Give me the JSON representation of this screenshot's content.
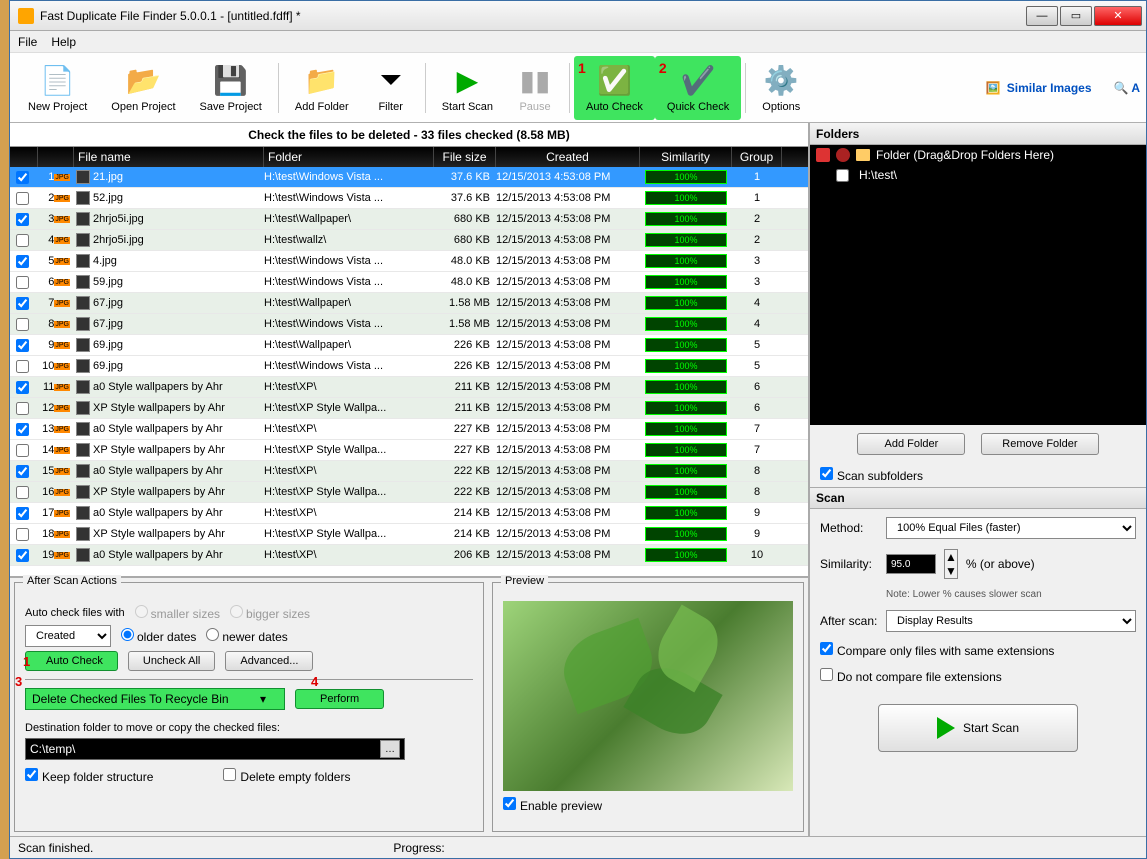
{
  "title": "Fast Duplicate File Finder 5.0.0.1 - [untitled.fdff] *",
  "menu": {
    "file": "File",
    "help": "Help"
  },
  "toolbar": {
    "new_project": "New Project",
    "open_project": "Open Project",
    "save_project": "Save Project",
    "add_folder": "Add Folder",
    "filter": "Filter",
    "start_scan": "Start Scan",
    "pause": "Pause",
    "auto_check": "Auto Check",
    "quick_check": "Quick Check",
    "options": "Options",
    "similar_images": "Similar Images",
    "annot1": "1",
    "annot2": "2"
  },
  "header_strip": "Check the files to be deleted - 33 files checked (8.58 MB)",
  "columns": {
    "name": "File name",
    "folder": "Folder",
    "size": "File size",
    "created": "Created",
    "similarity": "Similarity",
    "group": "Group"
  },
  "rows": [
    {
      "n": 1,
      "ck": true,
      "sel": true,
      "name": "21.jpg",
      "folder": "H:\\test\\Windows Vista ...",
      "size": "37.6 KB",
      "created": "12/15/2013 4:53:08 PM",
      "sim": "100%",
      "grp": "1"
    },
    {
      "n": 2,
      "ck": false,
      "name": "52.jpg",
      "folder": "H:\\test\\Windows Vista ...",
      "size": "37.6 KB",
      "created": "12/15/2013 4:53:08 PM",
      "sim": "100%",
      "grp": "1"
    },
    {
      "n": 3,
      "ck": true,
      "alt": true,
      "name": "2hrjo5i.jpg",
      "folder": "H:\\test\\Wallpaper\\",
      "size": "680 KB",
      "created": "12/15/2013 4:53:08 PM",
      "sim": "100%",
      "grp": "2"
    },
    {
      "n": 4,
      "ck": false,
      "alt": true,
      "name": "2hrjo5i.jpg",
      "folder": "H:\\test\\wallz\\",
      "size": "680 KB",
      "created": "12/15/2013 4:53:08 PM",
      "sim": "100%",
      "grp": "2"
    },
    {
      "n": 5,
      "ck": true,
      "name": "4.jpg",
      "folder": "H:\\test\\Windows Vista ...",
      "size": "48.0 KB",
      "created": "12/15/2013 4:53:08 PM",
      "sim": "100%",
      "grp": "3"
    },
    {
      "n": 6,
      "ck": false,
      "name": "59.jpg",
      "folder": "H:\\test\\Windows Vista ...",
      "size": "48.0 KB",
      "created": "12/15/2013 4:53:08 PM",
      "sim": "100%",
      "grp": "3"
    },
    {
      "n": 7,
      "ck": true,
      "alt": true,
      "name": "67.jpg",
      "folder": "H:\\test\\Wallpaper\\",
      "size": "1.58 MB",
      "created": "12/15/2013 4:53:08 PM",
      "sim": "100%",
      "grp": "4"
    },
    {
      "n": 8,
      "ck": false,
      "alt": true,
      "name": "67.jpg",
      "folder": "H:\\test\\Windows Vista ...",
      "size": "1.58 MB",
      "created": "12/15/2013 4:53:08 PM",
      "sim": "100%",
      "grp": "4"
    },
    {
      "n": 9,
      "ck": true,
      "name": "69.jpg",
      "folder": "H:\\test\\Wallpaper\\",
      "size": "226 KB",
      "created": "12/15/2013 4:53:08 PM",
      "sim": "100%",
      "grp": "5"
    },
    {
      "n": 10,
      "ck": false,
      "name": "69.jpg",
      "folder": "H:\\test\\Windows Vista ...",
      "size": "226 KB",
      "created": "12/15/2013 4:53:08 PM",
      "sim": "100%",
      "grp": "5"
    },
    {
      "n": 11,
      "ck": true,
      "alt": true,
      "name": "a0 Style wallpapers by Ahr",
      "folder": "H:\\test\\XP\\",
      "size": "211 KB",
      "created": "12/15/2013 4:53:08 PM",
      "sim": "100%",
      "grp": "6"
    },
    {
      "n": 12,
      "ck": false,
      "alt": true,
      "name": "XP Style wallpapers by Ahr",
      "folder": "H:\\test\\XP Style Wallpa...",
      "size": "211 KB",
      "created": "12/15/2013 4:53:08 PM",
      "sim": "100%",
      "grp": "6"
    },
    {
      "n": 13,
      "ck": true,
      "name": "a0 Style wallpapers by Ahr",
      "folder": "H:\\test\\XP\\",
      "size": "227 KB",
      "created": "12/15/2013 4:53:08 PM",
      "sim": "100%",
      "grp": "7"
    },
    {
      "n": 14,
      "ck": false,
      "name": "XP Style wallpapers by Ahr",
      "folder": "H:\\test\\XP Style Wallpa...",
      "size": "227 KB",
      "created": "12/15/2013 4:53:08 PM",
      "sim": "100%",
      "grp": "7"
    },
    {
      "n": 15,
      "ck": true,
      "alt": true,
      "name": "a0 Style wallpapers by Ahr",
      "folder": "H:\\test\\XP\\",
      "size": "222 KB",
      "created": "12/15/2013 4:53:08 PM",
      "sim": "100%",
      "grp": "8"
    },
    {
      "n": 16,
      "ck": false,
      "alt": true,
      "name": "XP Style wallpapers by Ahr",
      "folder": "H:\\test\\XP Style Wallpa...",
      "size": "222 KB",
      "created": "12/15/2013 4:53:08 PM",
      "sim": "100%",
      "grp": "8"
    },
    {
      "n": 17,
      "ck": true,
      "name": "a0 Style wallpapers by Ahr",
      "folder": "H:\\test\\XP\\",
      "size": "214 KB",
      "created": "12/15/2013 4:53:08 PM",
      "sim": "100%",
      "grp": "9"
    },
    {
      "n": 18,
      "ck": false,
      "name": "XP Style wallpapers by Ahr",
      "folder": "H:\\test\\XP Style Wallpa...",
      "size": "214 KB",
      "created": "12/15/2013 4:53:08 PM",
      "sim": "100%",
      "grp": "9"
    },
    {
      "n": 19,
      "ck": true,
      "alt": true,
      "name": "a0 Style wallpapers by Ahr",
      "folder": "H:\\test\\XP\\",
      "size": "206 KB",
      "created": "12/15/2013 4:53:08 PM",
      "sim": "100%",
      "grp": "10"
    }
  ],
  "after_scan": {
    "legend": "After Scan Actions",
    "auto_check_with": "Auto check files with",
    "smaller": "smaller sizes",
    "bigger": "bigger sizes",
    "older": "older dates",
    "newer": "newer dates",
    "created": "Created",
    "auto_check_btn": "Auto Check",
    "uncheck_all": "Uncheck All",
    "advanced": "Advanced...",
    "action_combo": "Delete Checked Files To Recycle Bin",
    "perform": "Perform",
    "dest_label": "Destination folder to move or copy the checked files:",
    "dest_value": "C:\\temp\\",
    "keep_struct": "Keep folder structure",
    "delete_empty": "Delete empty folders",
    "annot1": "1",
    "annot3": "3",
    "annot4": "4"
  },
  "preview": {
    "legend": "Preview",
    "enable": "Enable preview"
  },
  "folders": {
    "hdr": "Folders",
    "root": "Folder (Drag&Drop Folders Here)",
    "item1": "H:\\test\\",
    "add": "Add Folder",
    "remove": "Remove Folder",
    "scan_sub": "Scan subfolders"
  },
  "scan": {
    "hdr": "Scan",
    "method_lbl": "Method:",
    "method_val": "100% Equal Files (faster)",
    "sim_lbl": "Similarity:",
    "sim_val": "95.0",
    "sim_suffix": "%  (or above)",
    "note": "Note: Lower % causes slower scan",
    "after_lbl": "After scan:",
    "after_val": "Display Results",
    "compare_ext": "Compare only files with same extensions",
    "not_compare_ext": "Do not compare file extensions",
    "start": "Start Scan"
  },
  "status": {
    "left": "Scan finished.",
    "progress": "Progress:"
  }
}
